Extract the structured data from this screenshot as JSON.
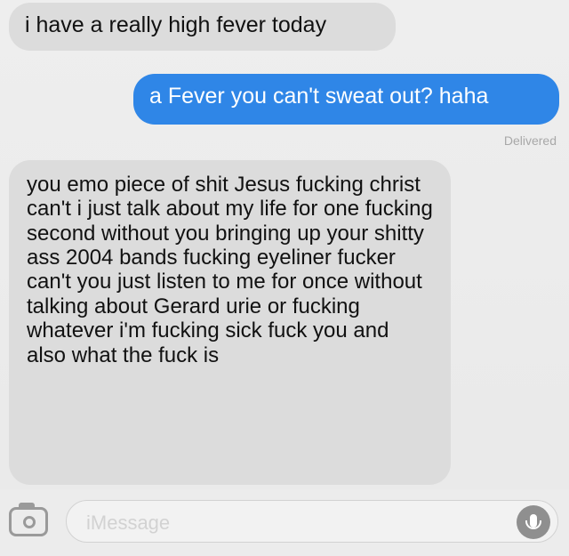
{
  "messages": [
    {
      "direction": "incoming",
      "text": "i have a really high fever today"
    },
    {
      "direction": "outgoing",
      "text": "a Fever you can't sweat out? haha"
    },
    {
      "direction": "incoming",
      "text": "you emo piece of shit Jesus fucking christ can't i just talk about my life for one fucking second without you bringing up your shitty ass 2004 bands fucking eyeliner fucker can't you just listen to me for once without talking about Gerard urie or fucking whatever i'm fucking sick fuck you and also what the fuck is"
    }
  ],
  "delivery_status": "Delivered",
  "composer": {
    "placeholder": "iMessage"
  },
  "colors": {
    "incoming_bubble": "#dcdcdc",
    "outgoing_bubble": "#2f86e7",
    "status_text": "#a8a8a8"
  },
  "icons": {
    "camera": "camera-icon",
    "microphone": "microphone-icon"
  }
}
